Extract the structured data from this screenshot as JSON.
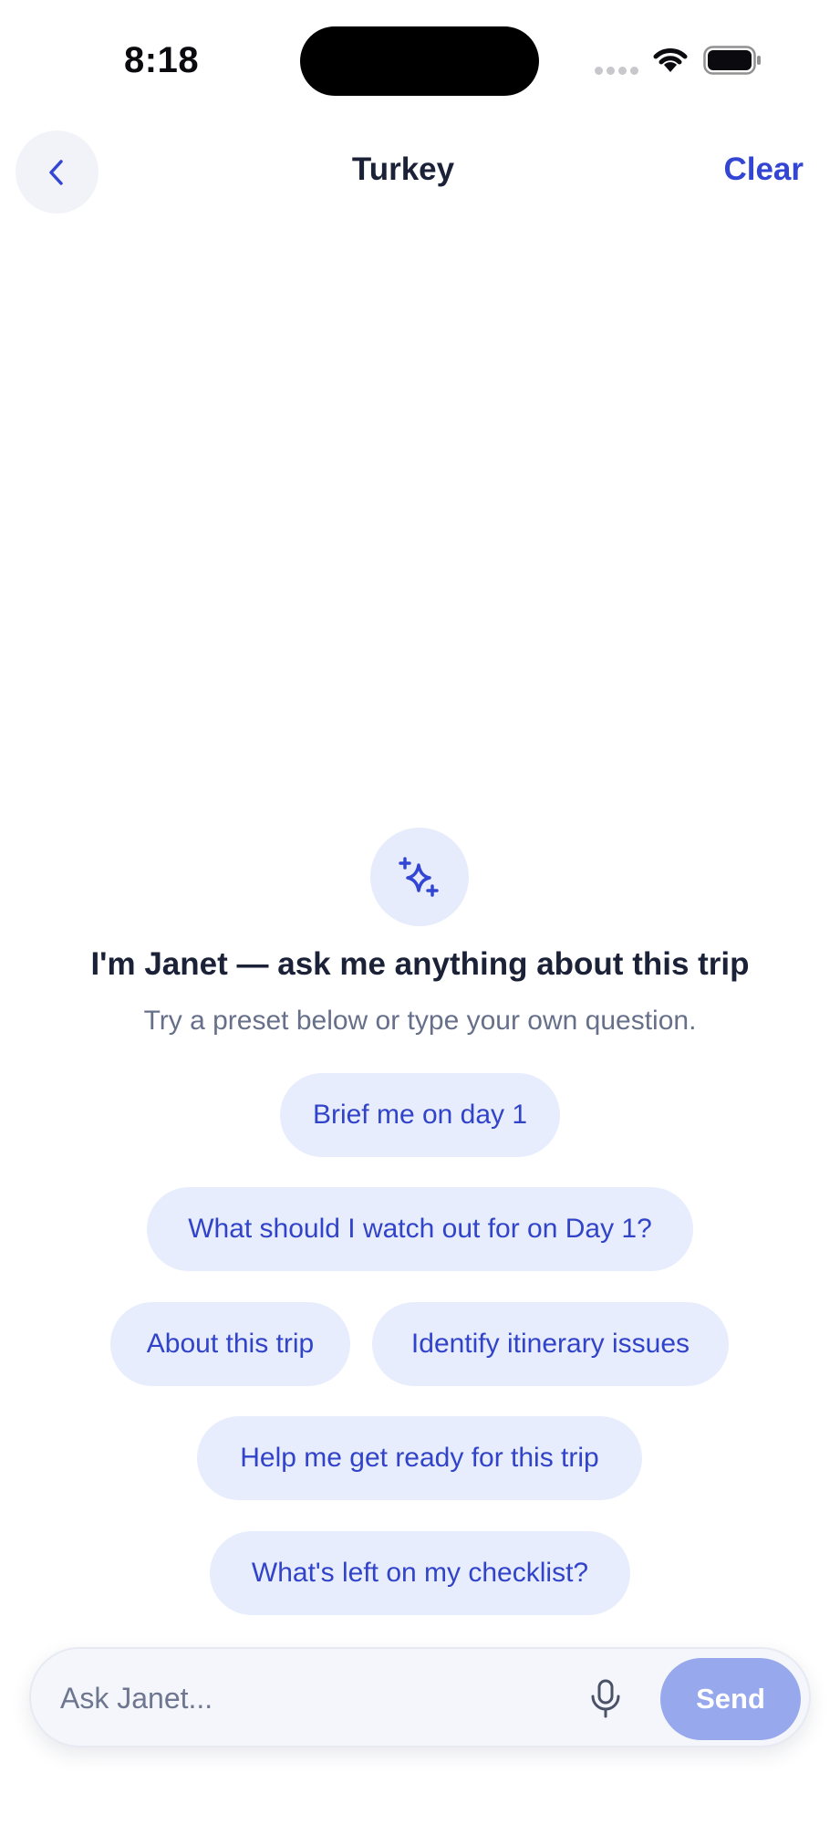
{
  "status_bar": {
    "time": "8:18"
  },
  "nav": {
    "back_icon": "chevron-left-icon",
    "title": "Turkey",
    "clear_label": "Clear"
  },
  "empty_state": {
    "icon": "sparkles-icon",
    "headline": "I'm Janet — ask me anything about this trip",
    "subline": "Try a preset below or type your own question."
  },
  "presets": [
    "Brief me on day 1",
    "What should I watch out for on Day 1?",
    "About this trip",
    "Identify itinerary issues",
    "Help me get ready for this trip",
    "What's left on my checklist?"
  ],
  "composer": {
    "placeholder": "Ask Janet...",
    "mic_icon": "microphone-icon",
    "send_label": "Send"
  },
  "colors": {
    "accent": "#3346d3",
    "chip_bg": "#e7edfc",
    "send_disabled": "#97a9ec",
    "title_text": "#1b2238",
    "muted_text": "#67708a"
  }
}
